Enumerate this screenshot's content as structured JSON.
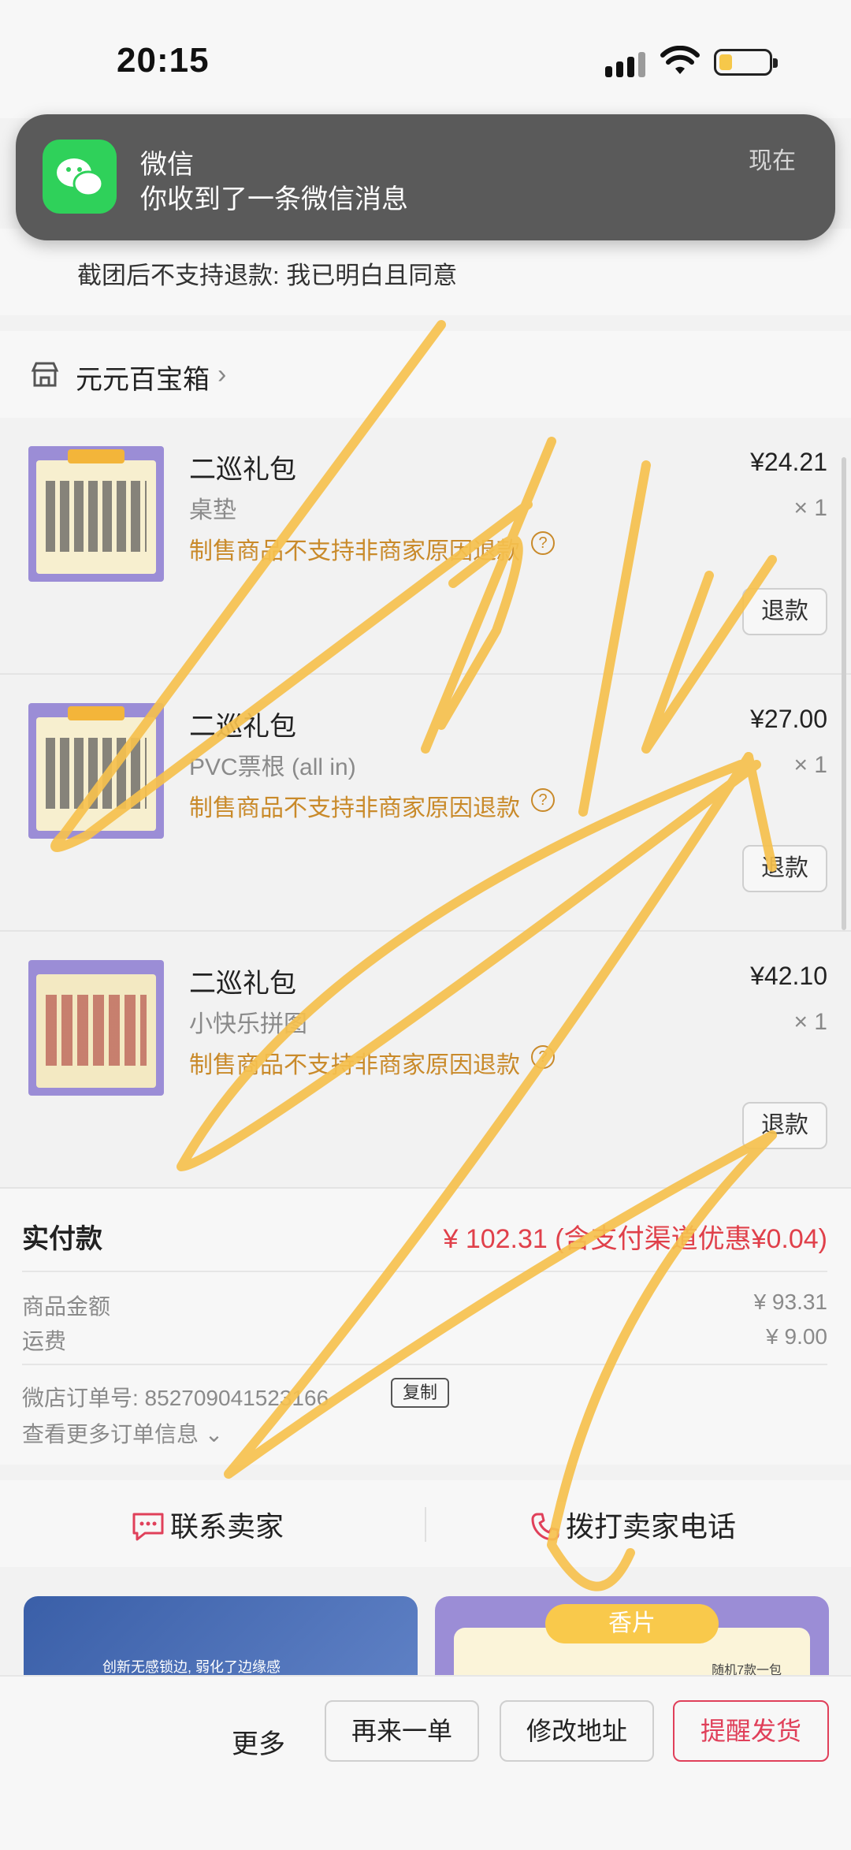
{
  "status_bar": {
    "time": "20:15"
  },
  "notification": {
    "app": "微信",
    "message": "你收到了一条微信消息",
    "time": "现在"
  },
  "notice": {
    "text": "截团后不支持退款: 我已明白且同意"
  },
  "shop": {
    "name": "元元百宝箱"
  },
  "items": [
    {
      "title": "二巡礼包",
      "spec": "桌垫",
      "warning": "制售商品不支持非商家原因退款",
      "price": "¥24.21",
      "qty": "× 1",
      "refund": "退款"
    },
    {
      "title": "二巡礼包",
      "spec": "PVC票根 (all in)",
      "warning": "制售商品不支持非商家原因退款",
      "price": "¥27.00",
      "qty": "× 1",
      "refund": "退款"
    },
    {
      "title": "二巡礼包",
      "spec": "小快乐拼图",
      "warning": "制售商品不支持非商家原因退款",
      "price": "¥42.10",
      "qty": "× 1",
      "refund": "退款"
    }
  ],
  "payment": {
    "label": "实付款",
    "total": "¥ 102.31 (含支付渠道优惠¥0.04)",
    "goods_label": "商品金额",
    "goods_value": "¥ 93.31",
    "shipping_label": "运费",
    "shipping_value": "¥ 9.00",
    "order_no": "微店订单号: 852709041523166",
    "copy": "复制",
    "more_info": "查看更多订单信息"
  },
  "contact": {
    "seller": "联系卖家",
    "call": "拨打卖家电话"
  },
  "recommend": {
    "left_text": "创新无感锁边, 弱化了边缘感",
    "right_banner": "香片",
    "right_small": "随机7款一包"
  },
  "bottom_bar": {
    "more": "更多",
    "reorder": "再来一单",
    "edit_address": "修改地址",
    "remind": "提醒发货"
  },
  "colors": {
    "accent": "#e0405a",
    "warning": "#c98a2a",
    "wechat": "#2fd15a",
    "scribble": "#f6c14e"
  }
}
